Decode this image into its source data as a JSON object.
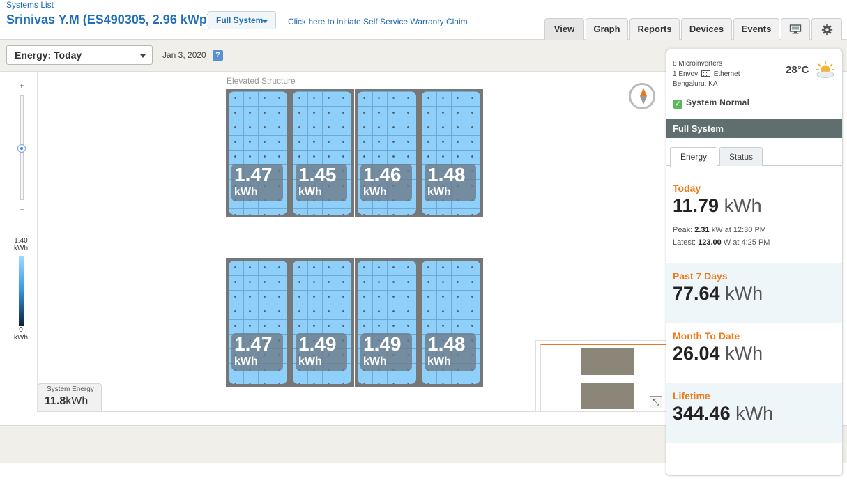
{
  "header": {
    "systems_link": "Systems List",
    "title": "Srinivas Y.M (ES490305, 2.96 kWp)",
    "full_system_label": "Full System",
    "warranty_link": "Click here to initiate Self Service Warranty Claim",
    "tabs": [
      {
        "label": "View",
        "active": true
      },
      {
        "label": "Graph",
        "active": false
      },
      {
        "label": "Reports",
        "active": false
      },
      {
        "label": "Devices",
        "active": false
      },
      {
        "label": "Events",
        "active": false
      }
    ]
  },
  "toolbar": {
    "energy_select": "Energy: Today",
    "date": "Jan 3, 2020",
    "help": "?"
  },
  "legend": {
    "max_value": "1.40",
    "max_unit": "kWh",
    "min_value": "0",
    "min_unit": "kWh"
  },
  "map": {
    "array_label": "Elevated Structure",
    "panels_top": [
      {
        "value": "1.47",
        "unit": "kWh"
      },
      {
        "value": "1.45",
        "unit": "kWh"
      },
      {
        "value": "1.46",
        "unit": "kWh"
      },
      {
        "value": "1.48",
        "unit": "kWh"
      }
    ],
    "panels_bottom": [
      {
        "value": "1.47",
        "unit": "kWh"
      },
      {
        "value": "1.49",
        "unit": "kWh"
      },
      {
        "value": "1.49",
        "unit": "kWh"
      },
      {
        "value": "1.48",
        "unit": "kWh"
      }
    ],
    "system_energy_label": "System Energy",
    "system_energy_value": "11.8",
    "system_energy_unit": "kWh",
    "zoom_in": "+",
    "zoom_out": "−"
  },
  "side": {
    "microinverters": "8 Microinverters",
    "envoy": "1 Envoy",
    "connection": "Ethernet",
    "location": "Bengaluru, KA",
    "temperature": "28°C",
    "status": "System Normal",
    "section_title": "Full System",
    "tabs": [
      {
        "label": "Energy",
        "active": true
      },
      {
        "label": "Status",
        "active": false
      }
    ],
    "today": {
      "label": "Today",
      "value": "11.79",
      "unit": "kWh",
      "peak_label": "Peak:",
      "peak_value": "2.31",
      "peak_rest": "kW at 12:30 PM",
      "latest_label": "Latest:",
      "latest_value": "123.00",
      "latest_rest": "W at 4:25 PM"
    },
    "past7": {
      "label": "Past 7 Days",
      "value": "77.64",
      "unit": "kWh"
    },
    "month": {
      "label": "Month To Date",
      "value": "26.04",
      "unit": "kWh"
    },
    "lifetime": {
      "label": "Lifetime",
      "value": "344.46",
      "unit": "kWh"
    }
  },
  "colors": {
    "brand_blue": "#1f6fb8",
    "accent_orange": "#f07a1a",
    "panel_blue": "#8fd0fa",
    "section_header": "#5f6e6f"
  }
}
